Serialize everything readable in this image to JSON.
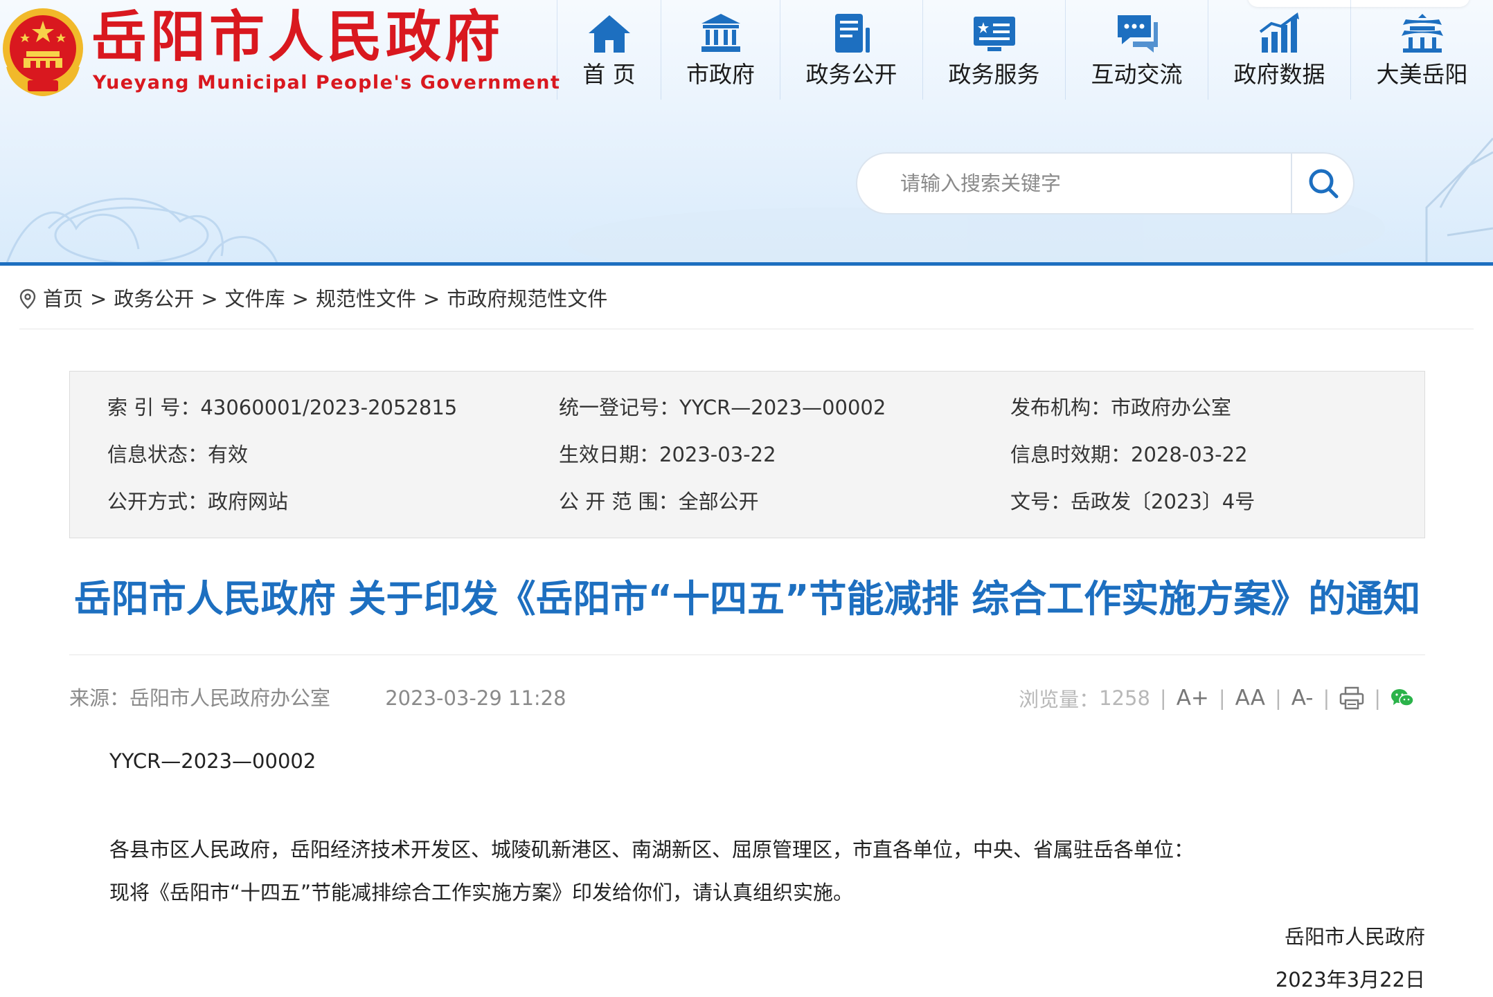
{
  "header": {
    "title_cn": "岳阳市人民政府",
    "title_en": "Yueyang Municipal People's Government",
    "emblem_icon": "national-emblem-icon",
    "nav": [
      {
        "label": "首 页",
        "icon": "home-icon"
      },
      {
        "label": "市政府",
        "icon": "government-building-icon"
      },
      {
        "label": "政务公开",
        "icon": "document-list-icon"
      },
      {
        "label": "政务服务",
        "icon": "service-card-icon"
      },
      {
        "label": "互动交流",
        "icon": "chat-bubble-icon"
      },
      {
        "label": "政府数据",
        "icon": "bar-chart-icon"
      },
      {
        "label": "大美岳阳",
        "icon": "pavilion-icon"
      }
    ],
    "search": {
      "placeholder": "请输入搜索关键字",
      "icon": "search-icon"
    },
    "colors": {
      "brand_red": "#d9181f",
      "accent_blue": "#1d6fc0"
    }
  },
  "breadcrumb": {
    "icon": "location-pin-icon",
    "items": [
      "首页",
      "政务公开",
      "文件库",
      "规范性文件",
      "市政府规范性文件"
    ],
    "separator": ">"
  },
  "info": {
    "index_no": "索 引 号：43060001/2023-2052815",
    "reg_no": "统一登记号：YYCR—2023—00002",
    "publisher": "发布机构：市政府办公室",
    "status": "信息状态：有效",
    "effective_date": "生效日期：2023-03-22",
    "expiry_date": "信息时效期：2028-03-22",
    "disclosure_method": "公开方式：政府网站",
    "disclosure_scope": "公 开 范 围：全部公开",
    "doc_no": "文号：岳政发〔2023〕4号"
  },
  "article": {
    "title": "岳阳市人民政府 关于印发《岳阳市“十四五”节能减排 综合工作实施方案》的通知",
    "source": "来源：岳阳市人民政府办公室",
    "date": "2023-03-29 11:28",
    "views_label": "浏览量：",
    "views": "1258",
    "font_larger": "A+",
    "font_reset": "AA",
    "font_smaller": "A-",
    "print_icon": "print-icon",
    "share_icon": "wechat-icon",
    "code": "YYCR—2023—00002",
    "paragraphs": [
      "各县市区人民政府，岳阳经济技术开发区、城陵矶新港区、南湖新区、屈原管理区，市直各单位，中央、省属驻岳各单位：",
      "现将《岳阳市“十四五”节能减排综合工作实施方案》印发给你们，请认真组织实施。"
    ],
    "signer": "岳阳市人民政府",
    "sign_date": "2023年3月22日"
  }
}
